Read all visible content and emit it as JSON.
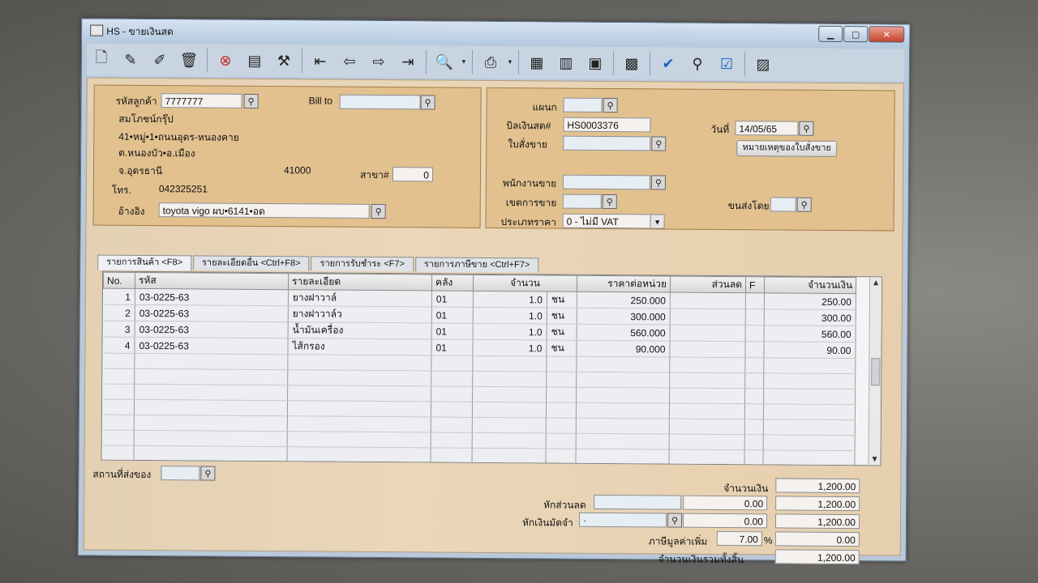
{
  "window": {
    "title": "HS - ขายเงินสด",
    "min": "▁",
    "max": "▢",
    "close": "✕"
  },
  "toolbar": {
    "icons": [
      "new-doc-icon",
      "edit-icon",
      "edit-alt-icon",
      "delete-icon",
      "cancel-icon",
      "print-preview-icon",
      "tools-icon",
      "first-icon",
      "prev-icon",
      "next-icon",
      "last-icon",
      "search-doc-icon",
      "printer-icon",
      "report-a-icon",
      "report-b-icon",
      "report-c-icon",
      "report-d-icon",
      "ok-icon",
      "link-icon",
      "ok-alt-icon",
      "calculator-icon"
    ]
  },
  "customer": {
    "code_label": "รหัสลูกค้า",
    "code_value": "7777777",
    "bill_to_label": "Bill to",
    "name": "สมโภชน์กรุ๊ป",
    "addr1": "41•หมู่•1•ถนนอุดร-หนองคาย",
    "addr2": "ต.หนองบัว•อ.เมือง",
    "addr3": "จ.อุดรธานี",
    "zip": "41000",
    "branch_label": "สาขา#",
    "branch_value": "0",
    "phone_label": "โทร.",
    "phone_value": "042325251",
    "ref_label": "อ้างอิง",
    "ref_value": "toyota vigo ผบ•6141•อด"
  },
  "document": {
    "dept_label": "แผนก",
    "bill_label": "บิลเงินสด#",
    "bill_value": "HS0003376",
    "order_label": "ใบสั่งขาย",
    "date_label": "วันที่",
    "date_value": "14/05/65",
    "note_button": "หมายเหตุของใบสั่งขาย",
    "sales_label": "พนักงานขาย",
    "zone_label": "เขตการขาย",
    "ship_label": "ขนส่งโดย",
    "price_type_label": "ประเภทราคา",
    "price_type_value": "0 - ไม่มี VAT"
  },
  "tabs": [
    {
      "label": "รายการสินค้า <F8>"
    },
    {
      "label": "รายละเอียดอื่น <Ctrl+F8>"
    },
    {
      "label": "รายการรับชำระ <F7>"
    },
    {
      "label": "รายการภาษีขาย <Ctrl+F7>"
    }
  ],
  "grid": {
    "headers": {
      "no": "No.",
      "code": "รหัส",
      "desc": "รายละเอียด",
      "wh": "คลัง",
      "qty": "จำนวน",
      "price": "ราคาต่อหน่วย",
      "disc": "ส่วนลด",
      "f": "F",
      "amount": "จำนวนเงิน"
    },
    "rows": [
      {
        "no": "1",
        "code": "03-0225-63",
        "desc": "ยางฝาวาล์",
        "wh": "01",
        "qty": "1.0",
        "unit": "ชน",
        "price": "250.000",
        "amount": "250.00"
      },
      {
        "no": "2",
        "code": "03-0225-63",
        "desc": "ยางฝาวาล์ว",
        "wh": "01",
        "qty": "1.0",
        "unit": "ชน",
        "price": "300.000",
        "amount": "300.00"
      },
      {
        "no": "3",
        "code": "03-0225-63",
        "desc": "น้ำมันเครื่อง",
        "wh": "01",
        "qty": "1.0",
        "unit": "ชน",
        "price": "560.000",
        "amount": "560.00"
      },
      {
        "no": "4",
        "code": "03-0225-63",
        "desc": "ไส้กรอง",
        "wh": "01",
        "qty": "1.0",
        "unit": "ชน",
        "price": "90.000",
        "amount": "90.00"
      }
    ],
    "scroll_up": "▲",
    "scroll_down": "▼"
  },
  "footer": {
    "ship_place_label": "สถานที่ส่งของ",
    "amount_label": "จำนวนเงิน",
    "amount_value": "1,200.00",
    "discount_label": "หักส่วนลด",
    "discount_value": "0.00",
    "after_discount": "1,200.00",
    "deposit_label": "หักเงินมัดจำ",
    "deposit_code": "·",
    "deposit_value": "0.00",
    "after_deposit": "1,200.00",
    "vat_label": "ภาษีมูลค่าเพิ่ม",
    "vat_rate": "7.00",
    "vat_percent": "%",
    "vat_value": "0.00",
    "total_label": "จำนวนเงินรวมทั้งสิ้น",
    "total_value": "1,200.00"
  }
}
